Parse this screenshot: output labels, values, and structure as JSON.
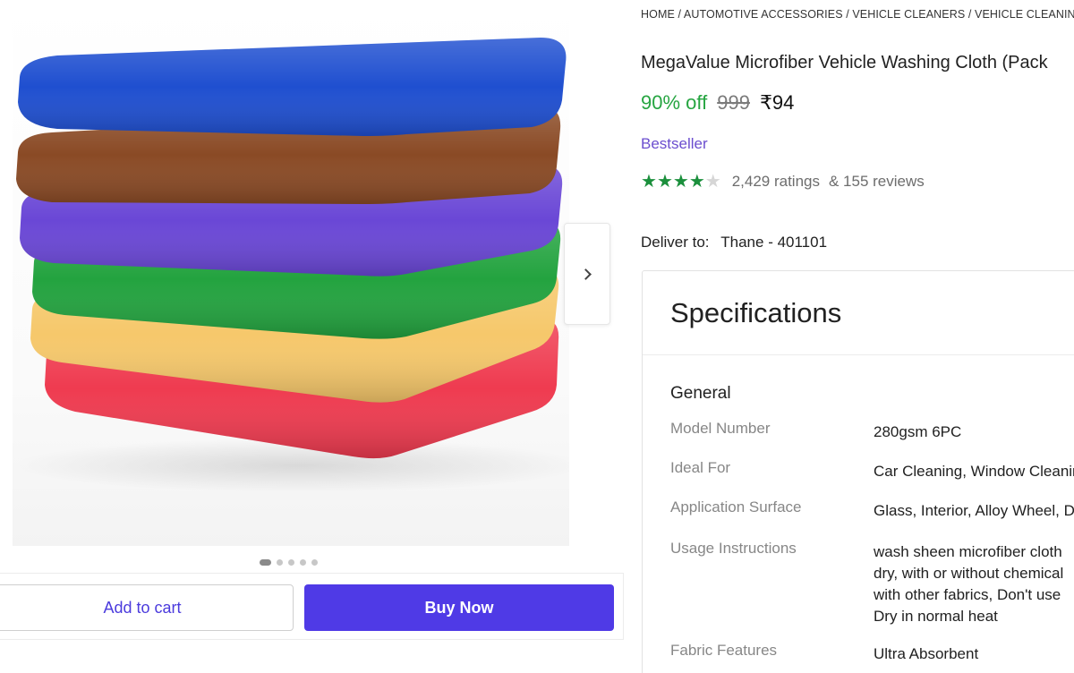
{
  "breadcrumb": "HOME / AUTOMOTIVE ACCESSORIES / VEHICLE CLEANERS / VEHICLE CLEANING",
  "product": {
    "title": "MegaValue Microfiber Vehicle Washing  Cloth (Pack",
    "discount": "90% off",
    "mrp": "999",
    "price": "₹94",
    "badge": "Bestseller",
    "rating_value": 4,
    "ratings_text": "2,429 ratings",
    "reviews_text": "& 155 reviews"
  },
  "delivery": {
    "label": "Deliver to:",
    "location": "Thane - 401101"
  },
  "gallery": {
    "image_count": 5,
    "active_index": 0
  },
  "actions": {
    "add_to_cart": "Add to cart",
    "buy_now": "Buy Now"
  },
  "specifications": {
    "heading": "Specifications",
    "group": "General",
    "rows": [
      {
        "key": "Model Number",
        "value": "280gsm 6PC"
      },
      {
        "key": "Ideal For",
        "value": "Car Cleaning, Window Cleaning"
      },
      {
        "key": "Application Surface",
        "value": "Glass, Interior, Alloy Wheel, D"
      },
      {
        "key": "Usage Instructions",
        "value": "wash sheen microfiber cloth\ndry, with or without chemical\nwith other fabrics, Don't use\nDry in normal heat"
      },
      {
        "key": "Fabric Features",
        "value": "Ultra Absorbent"
      }
    ]
  },
  "towel_colors": [
    "#1f4fd0",
    "#8a4a25",
    "#6a47d6",
    "#23a33f",
    "#f6c86b",
    "#ef3b50"
  ],
  "colors": {
    "accent": "#4f3ae6",
    "discount": "#26a541",
    "badge": "#6b4ecf",
    "star": "#1b8f3c"
  }
}
